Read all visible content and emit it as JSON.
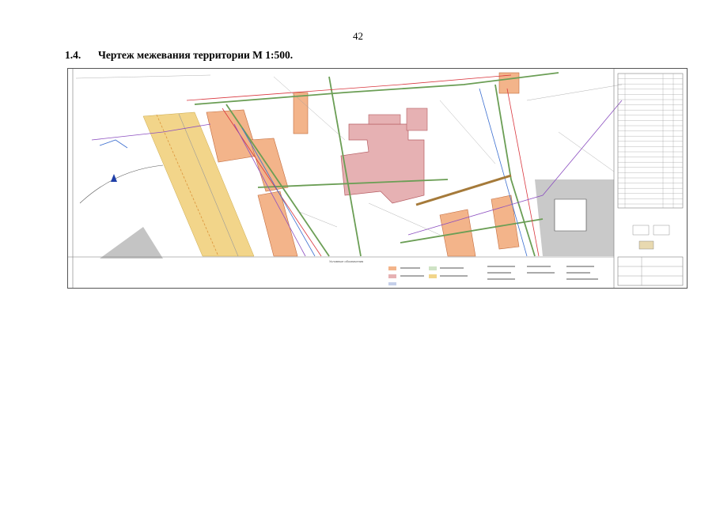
{
  "page": {
    "number": "42"
  },
  "section": {
    "number": "1.4.",
    "title": "Чертеж межевания территории М 1:500."
  },
  "drawing": {
    "legend_title": "Условные обозначения",
    "colors": {
      "road_yellow": "#f2d58a",
      "building_orange": "#f3b48a",
      "building_pink": "#e6b1b3",
      "boundary_green": "#6b9e55",
      "boundary_red": "#d9363e",
      "network_purple": "#8c4fc0",
      "network_blue": "#3c6fd0",
      "shade_gray": "#bfbfbf"
    }
  }
}
